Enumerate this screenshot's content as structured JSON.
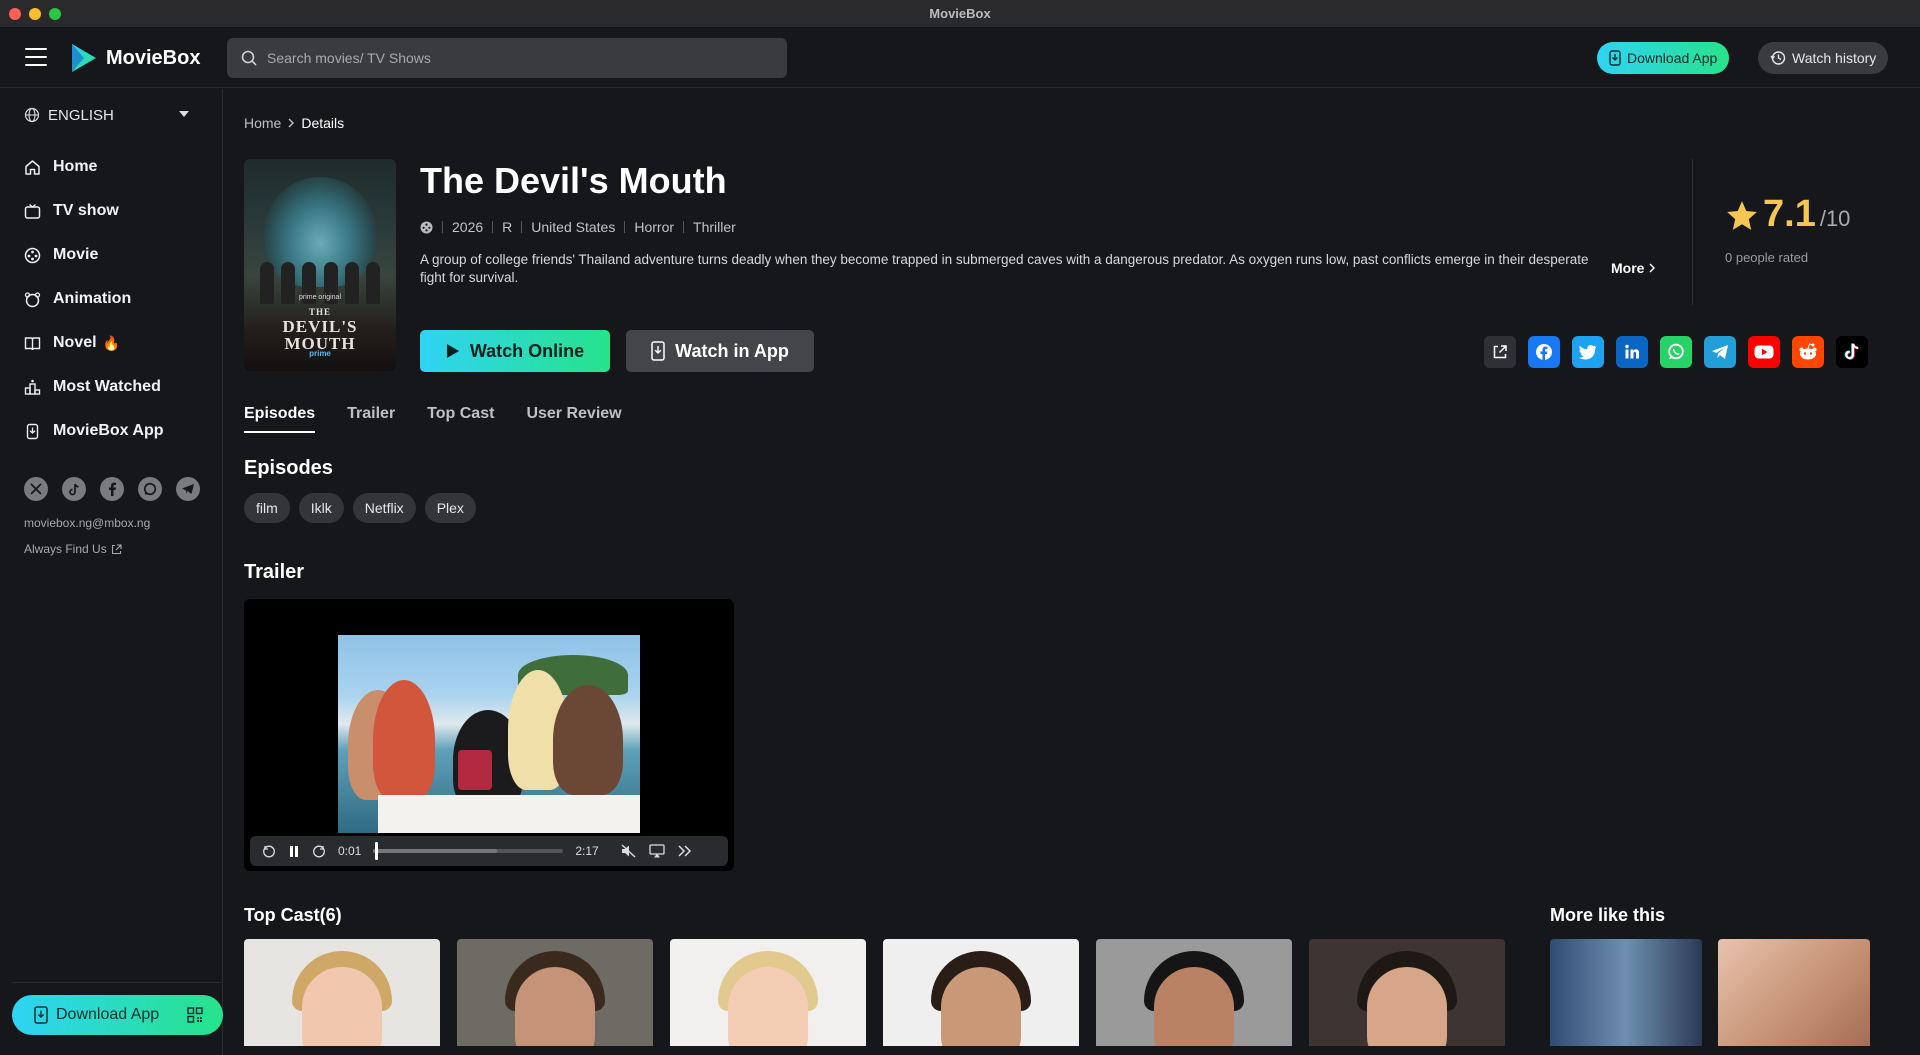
{
  "window": {
    "title": "MovieBox"
  },
  "header": {
    "brand": "MovieBox",
    "search_placeholder": "Search movies/ TV Shows",
    "download_label": "Download App",
    "history_label": "Watch history"
  },
  "sidebar": {
    "language": "ENGLISH",
    "items": [
      {
        "label": "Home",
        "icon": "home-icon"
      },
      {
        "label": "TV show",
        "icon": "tv-icon"
      },
      {
        "label": "Movie",
        "icon": "film-reel-icon"
      },
      {
        "label": "Animation",
        "icon": "bear-icon"
      },
      {
        "label": "Novel",
        "icon": "book-icon",
        "badge": "🔥"
      },
      {
        "label": "Most Watched",
        "icon": "podium-icon"
      },
      {
        "label": "MovieBox App",
        "icon": "phone-icon"
      }
    ],
    "social_icons": [
      "x-icon",
      "tiktok-icon",
      "facebook-icon",
      "whatsapp-icon",
      "telegram-icon"
    ],
    "email": "moviebox.ng@mbox.ng",
    "find_us": "Always Find Us",
    "download_label": "Download App"
  },
  "breadcrumb": {
    "home": "Home",
    "current": "Details"
  },
  "movie": {
    "poster": {
      "tagline": "prime original",
      "title_line1": "THE",
      "title_line2": "DEVIL'S",
      "title_line3": "MOUTH",
      "footer": "prime"
    },
    "title": "The Devil's Mouth",
    "year": "2026",
    "rating_cert": "R",
    "country": "United States",
    "genres": [
      "Horror",
      "Thriller"
    ],
    "description": "A group of college friends' Thailand adventure turns deadly when they become trapped in submerged caves with a dangerous predator. As oxygen runs low, past conflicts emerge in their desperate fight for survival.",
    "more_label": "More",
    "score": "7.1",
    "score_max": "/10",
    "rated_count": "0 people rated"
  },
  "actions": {
    "watch_online": "Watch Online",
    "watch_in_app": "Watch in App"
  },
  "share_icons": [
    {
      "icon": "external-link-icon",
      "color": "#2f3035"
    },
    {
      "icon": "facebook-icon",
      "color": "#1877f2"
    },
    {
      "icon": "twitter-icon",
      "color": "#1da1f2"
    },
    {
      "icon": "linkedin-icon",
      "color": "#0a66c2"
    },
    {
      "icon": "whatsapp-icon",
      "color": "#25d366"
    },
    {
      "icon": "telegram-icon",
      "color": "#229ed9"
    },
    {
      "icon": "youtube-icon",
      "color": "#ff0000"
    },
    {
      "icon": "reddit-icon",
      "color": "#ff4500"
    },
    {
      "icon": "tiktok-icon",
      "color": "#000000"
    }
  ],
  "tabs": [
    "Episodes",
    "Trailer",
    "Top Cast",
    "User Review"
  ],
  "episodes": {
    "heading": "Episodes",
    "sources": [
      "film",
      "Iklk",
      "Netflix",
      "Plex"
    ]
  },
  "trailer": {
    "heading": "Trailer",
    "current_time": "0:01",
    "duration": "2:17",
    "progress": 0.007,
    "buffered": 0.65
  },
  "cast": {
    "heading": "Top Cast(6)",
    "count": 6
  },
  "more_like_this": {
    "heading": "More like this"
  },
  "colors": {
    "accent_start": "#2fd3f5",
    "accent_end": "#27e38a",
    "star": "#f6c652",
    "background": "#16171b"
  }
}
